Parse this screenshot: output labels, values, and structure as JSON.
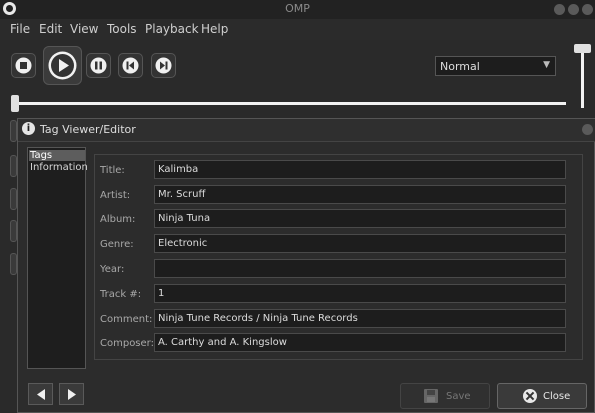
{
  "app": {
    "title": "OMP"
  },
  "menu": [
    "File",
    "Edit",
    "View",
    "Tools",
    "Playback",
    "Help"
  ],
  "playback": {
    "mode": "Normal"
  },
  "dialog": {
    "title": "Tag Viewer/Editor",
    "nav": [
      "Tags",
      "Information"
    ],
    "selected_nav": "Tags",
    "fields": [
      {
        "label": "Title:",
        "value": "Kalimba"
      },
      {
        "label": "Artist:",
        "value": "Mr. Scruff"
      },
      {
        "label": "Album:",
        "value": "Ninja Tuna"
      },
      {
        "label": "Genre:",
        "value": "Electronic"
      },
      {
        "label": "Year:",
        "value": ""
      },
      {
        "label": "Track #:",
        "value": "1"
      },
      {
        "label": "Comment:",
        "value": "Ninja Tune Records / Ninja Tune Records"
      },
      {
        "label": "Composer:",
        "value": "A. Carthy and A. Kingslow"
      }
    ],
    "save_label": "Save",
    "close_label": "Close"
  },
  "colors": {
    "background": "#2a2a2a",
    "field_bg": "#1d1d1d",
    "selected": "#5d5d5d"
  }
}
